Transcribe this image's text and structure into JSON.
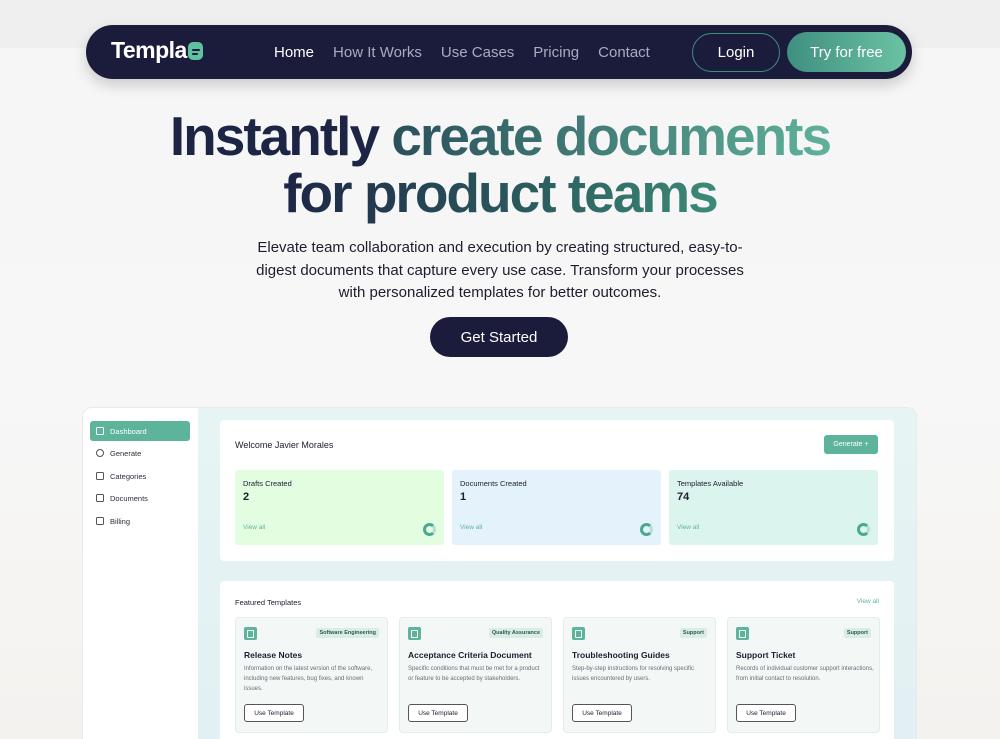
{
  "nav": {
    "logo_text": "Templa",
    "links": [
      "Home",
      "How It Works",
      "Use Cases",
      "Pricing",
      "Contact"
    ],
    "login_label": "Login",
    "try_label": "Try for free"
  },
  "hero": {
    "title_part1": "Instantly ",
    "title_part2": "create documents",
    "title_line2": "for product teams",
    "subtitle": "Elevate team collaboration and execution by creating structured, easy-to-digest documents that capture every use case. Transform your processes with personalized templates for better outcomes.",
    "cta_label": "Get Started"
  },
  "dashboard": {
    "sidebar": [
      {
        "label": "Dashboard",
        "icon": "grid-icon"
      },
      {
        "label": "Generate",
        "icon": "sparkle-icon"
      },
      {
        "label": "Categories",
        "icon": "columns-icon"
      },
      {
        "label": "Documents",
        "icon": "folder-icon"
      },
      {
        "label": "Billing",
        "icon": "card-icon"
      }
    ],
    "welcome": "Welcome Javier Morales",
    "generate_label": "Generate +",
    "stats": [
      {
        "label": "Drafts Created",
        "value": "2",
        "link": "View all",
        "color": "#e3fde0"
      },
      {
        "label": "Documents Created",
        "value": "1",
        "link": "View all",
        "color": "#e3f2fb"
      },
      {
        "label": "Templates Available",
        "value": "74",
        "link": "View all",
        "color": "#dcf4ee"
      }
    ],
    "featured_title": "Featured Templates",
    "featured_view_all": "View all",
    "templates": [
      {
        "tag": "Software Engineering",
        "name": "Release Notes",
        "desc": "Information on the latest version of the software, including new features, bug fixes, and known issues.",
        "button": "Use Template"
      },
      {
        "tag": "Quality Assurance",
        "name": "Acceptance Criteria Document",
        "desc": "Specific conditions that must be met for a product or feature to be accepted by stakeholders.",
        "button": "Use Template"
      },
      {
        "tag": "Support",
        "name": "Troubleshooting Guides",
        "desc": "Step-by-step instructions for resolving specific issues encountered by users.",
        "button": "Use Template"
      },
      {
        "tag": "Support",
        "name": "Support Ticket",
        "desc": "Records of individual customer support interactions, from initial contact to resolution.",
        "button": "Use Template"
      }
    ]
  }
}
